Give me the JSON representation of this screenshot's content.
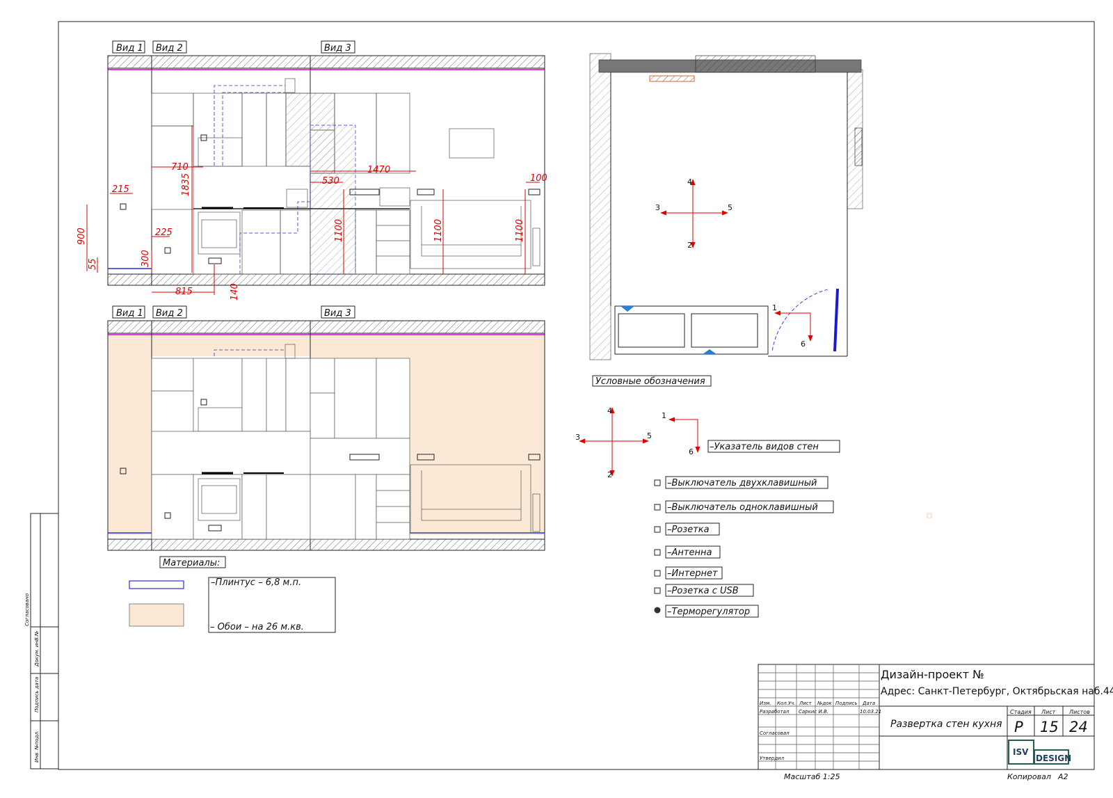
{
  "views": {
    "top": {
      "v1": "Вид 1",
      "v2": "Вид 2",
      "v3": "Вид 3"
    },
    "bottom": {
      "v1": "Вид 1",
      "v2": "Вид 2",
      "v3": "Вид 3"
    }
  },
  "dimensions": {
    "d215": "215",
    "d710": "710",
    "d1835": "1835",
    "d530": "530",
    "d1470": "1470",
    "d100": "100",
    "d900": "900",
    "d225": "225",
    "d300": "300",
    "d55": "55",
    "d1100a": "1100",
    "d1100b": "1100",
    "d1100c": "1100",
    "d815": "815",
    "d140": "140"
  },
  "plan": {
    "n4": "4",
    "n3": "3",
    "n5": "5",
    "n2": "2",
    "n1": "1",
    "n6": "6"
  },
  "legend": {
    "title": "Условные обозначения",
    "n4": "4",
    "n3": "3",
    "n5": "5",
    "n2": "2",
    "n1": "1",
    "n6": "6",
    "items": [
      {
        "label": "–Указатель видов стен"
      },
      {
        "label": "–Выключатель двухклавишный"
      },
      {
        "label": "–Выключатель одноклавишный"
      },
      {
        "label": "–Розетка"
      },
      {
        "label": "–Антенна"
      },
      {
        "label": "–Интернет"
      },
      {
        "label": "–Розетка с USB"
      },
      {
        "label": "–Терморегулятор"
      }
    ]
  },
  "materials": {
    "title": "Материалы:",
    "plinth": "–Плинтус – 6,8 м.п.",
    "wallpaper": "–   Обои – на 26 м.кв."
  },
  "colors": {
    "accent_red": "#e00000",
    "wallpaper": "#fbe9d6",
    "plinth": "#2b2bd6",
    "pink": "#e040e0"
  },
  "side_stamp": {
    "s1": "Согласовано",
    "s2": "Инв. №подл.",
    "s3": "Подпись дата",
    "s4": "Докум. инВ.№"
  },
  "title_block": {
    "project": "Дизайн-проект №",
    "address": "Адрес: Санкт-Петербург, Октябрьская наб.44",
    "sheet_name": "Развертка стен кухня",
    "col_izm": "Изм.",
    "col_kol": "Кол.Уч.",
    "col_list": "Лист",
    "col_ndok": "№док",
    "col_podpis": "Подпись",
    "col_data": "Дата",
    "razrabotal": "Разработал",
    "author": "Саркис И.В.",
    "date": "10.03.21",
    "soglasoval": "Согласовал",
    "utverdil": "Утвердил",
    "stage_label": "Стадия",
    "list_label": "Лист",
    "listov_label": "Листов",
    "stage": "Р",
    "list": "15",
    "listov": "24",
    "logo_isv": "ISV",
    "logo_design": "DESIGN",
    "scale": "Масштаб 1:25",
    "copied": "Копировал",
    "format": "A2"
  }
}
